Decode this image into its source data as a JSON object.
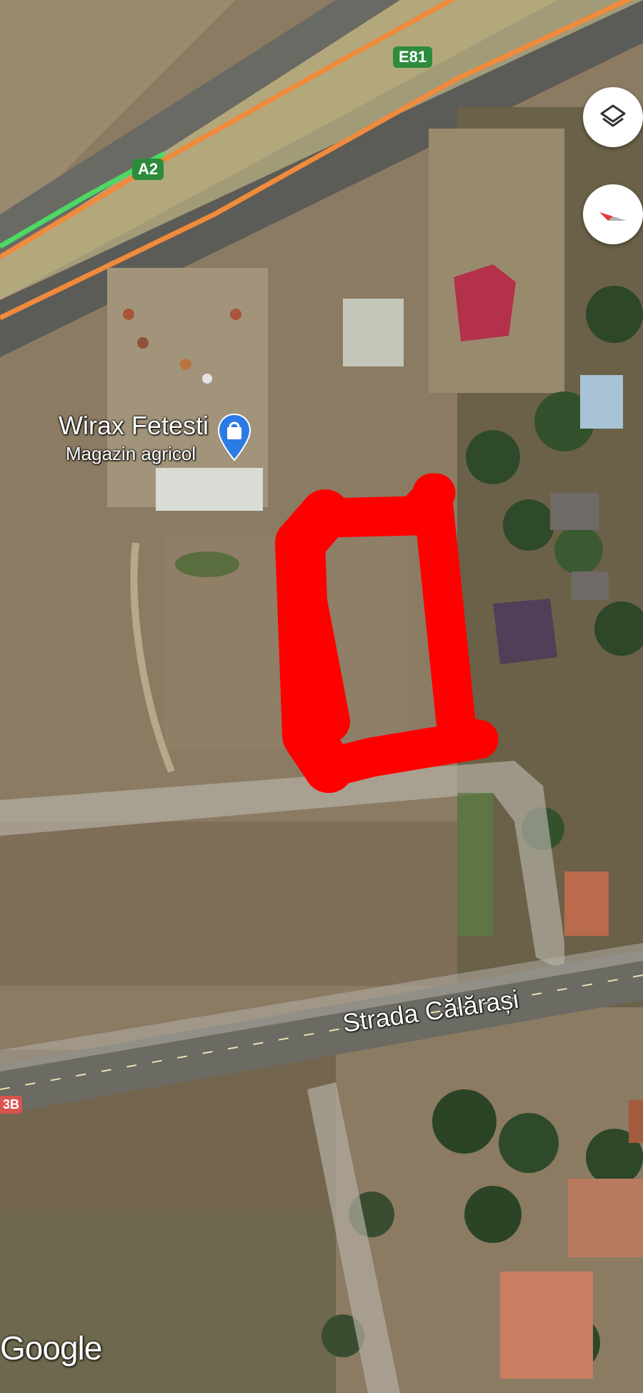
{
  "map": {
    "poi": {
      "name": "Wirax Fetesti",
      "category": "Magazin agricol",
      "icon": "shopping-bag-icon"
    },
    "street_label": "Strada Călărași",
    "road_shields": {
      "e81": "E81",
      "a2": "A2",
      "edge": "3B"
    },
    "attribution": "Google",
    "controls": {
      "layers": "layers-icon",
      "compass": "compass-icon"
    },
    "colors": {
      "highway_orange": "#f08a3c",
      "highway_green": "#4cd964",
      "annotation_red": "#ff0000",
      "shield_green": "#2e8b3e",
      "poi_blue": "#2c7be5"
    }
  }
}
